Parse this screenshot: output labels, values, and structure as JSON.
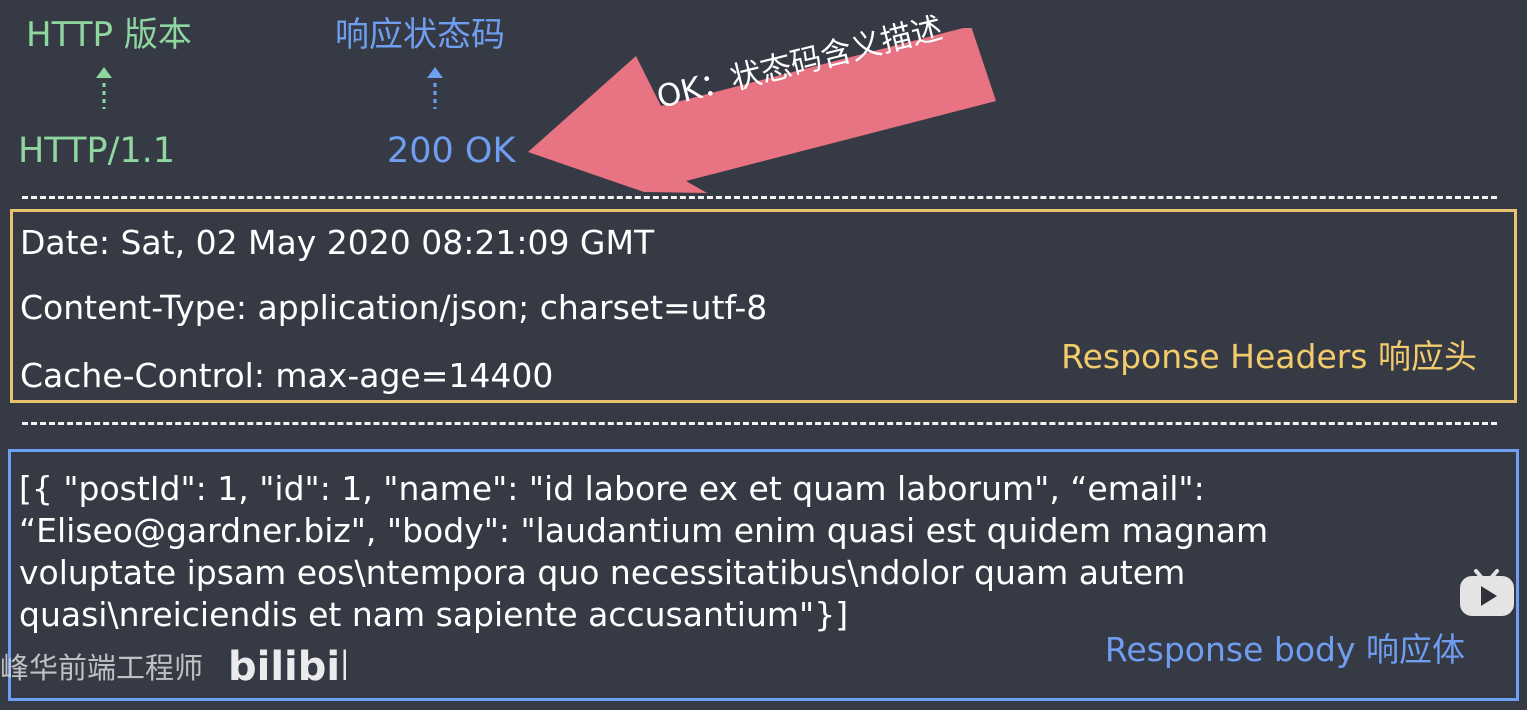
{
  "top": {
    "http_version_label": "HTTP 版本",
    "status_code_label": "响应状态码"
  },
  "status_line": {
    "version": "HTTP/1.1",
    "status": "200 OK"
  },
  "callout": {
    "text": "OK：状态码含义描述",
    "color": "#e87382"
  },
  "headers": {
    "lines": [
      "Date: Sat, 02 May 2020 08:21:09 GMT",
      "Content-Type: application/json; charset=utf-8",
      "Cache-Control: max-age=14400"
    ],
    "label": "Response Headers 响应头",
    "border_color": "#e7c36f"
  },
  "body": {
    "text": "[{ \"postId\": 1, \"id\": 1, \"name\": \"id labore ex et quam laborum\", “email\":\n“Eliseo@gardner.biz\", \"body\": \"laudantium enim quasi est quidem magnam\nvoluptate ipsam eos\\ntempora quo necessitatibus\\ndolor quam autem\nquasi\\nreiciendis et nam sapiente accusantium\"}]",
    "label": "Response body 响应体",
    "border_color": "#6d9ff5"
  },
  "watermark": {
    "text": "峰华前端工程师",
    "logo": "bilibili"
  },
  "icons": {
    "play_badge": "bilibili-play-icon"
  }
}
